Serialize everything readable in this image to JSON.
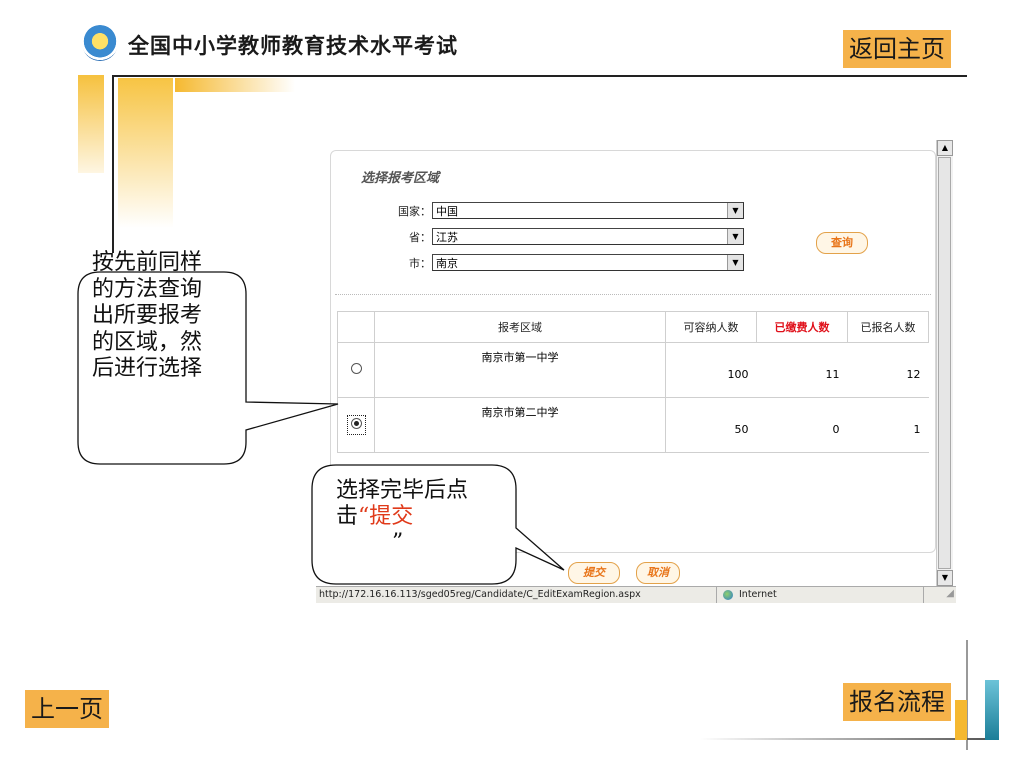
{
  "header": {
    "site_title": "全国中小学教师教育技术水平考试",
    "home_button": "返回主页"
  },
  "footer": {
    "prev_button": "上一页",
    "flow_button": "报名流程"
  },
  "form": {
    "section_title": "选择报考区域",
    "country_label": "国家：",
    "country_value": "中国",
    "province_label": "省：",
    "province_value": "江苏",
    "city_label": "市：",
    "city_value": "南京",
    "query_button": "查询"
  },
  "table": {
    "headers": [
      "报考区域",
      "可容纳人数",
      "已缴费人数",
      "已报名人数"
    ],
    "rows": [
      {
        "region": "南京市第一中学",
        "capacity": "100",
        "paid": "11",
        "registered": "12",
        "selected": false
      },
      {
        "region": "南京市第二中学",
        "capacity": "50",
        "paid": "0",
        "registered": "1",
        "selected": true
      }
    ]
  },
  "actions": {
    "submit_button": "提交",
    "cancel_button": "取消"
  },
  "statusbar": {
    "url": "http://172.16.16.113/sged05reg/Candidate/C_EditExamRegion.aspx",
    "zone": "Internet"
  },
  "callouts": {
    "instruction1": "按先前同样的方法查询出所要报考的区域，然后进行选择",
    "instruction2_prefix": "选择完毕后点击",
    "instruction2_highlight": "“提交",
    "instruction2_suffix": "”"
  },
  "colors": {
    "nav_button": "#f5b24a",
    "accent_red": "#e0101a",
    "action_orange": "#e8751a"
  }
}
